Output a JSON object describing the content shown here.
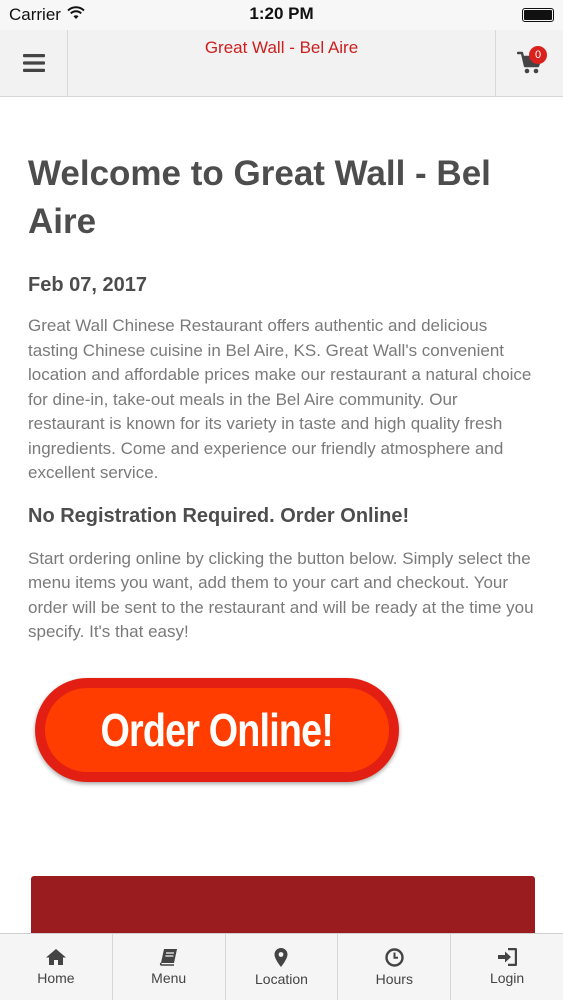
{
  "status_bar": {
    "carrier": "Carrier",
    "time": "1:20 PM"
  },
  "header": {
    "title": "Great Wall - Bel Aire",
    "cart_count": "0"
  },
  "content": {
    "title": "Welcome to Great Wall - Bel Aire",
    "date": "Feb 07, 2017",
    "intro": "Great Wall Chinese Restaurant offers authentic and delicious tasting Chinese cuisine in Bel Aire, KS.  Great Wall's convenient location and affordable prices make our restaurant a natural choice for dine-in, take-out meals in the Bel Aire community. Our restaurant is known for its variety in taste and high quality fresh ingredients. Come and experience our friendly atmosphere and excellent service.",
    "subheading": "No Registration Required. Order Online!",
    "order_text": "Start ordering online by clicking the button below. Simply select the menu items you want, add them to your cart and checkout. Your order will be sent to the restaurant and will be ready at the time you specify. It's that easy!",
    "order_button_label": "Order Online!"
  },
  "tabs": [
    {
      "label": "Home",
      "icon": "home-icon"
    },
    {
      "label": "Menu",
      "icon": "book-icon"
    },
    {
      "label": "Location",
      "icon": "map-pin-icon"
    },
    {
      "label": "Hours",
      "icon": "clock-icon"
    },
    {
      "label": "Login",
      "icon": "login-icon"
    }
  ],
  "colors": {
    "brand_red": "#cc1f1f",
    "button_orange": "#ff3d00",
    "button_ring": "#e31f14",
    "banner_red": "#9b1c1f",
    "badge_red": "#d9211d"
  }
}
